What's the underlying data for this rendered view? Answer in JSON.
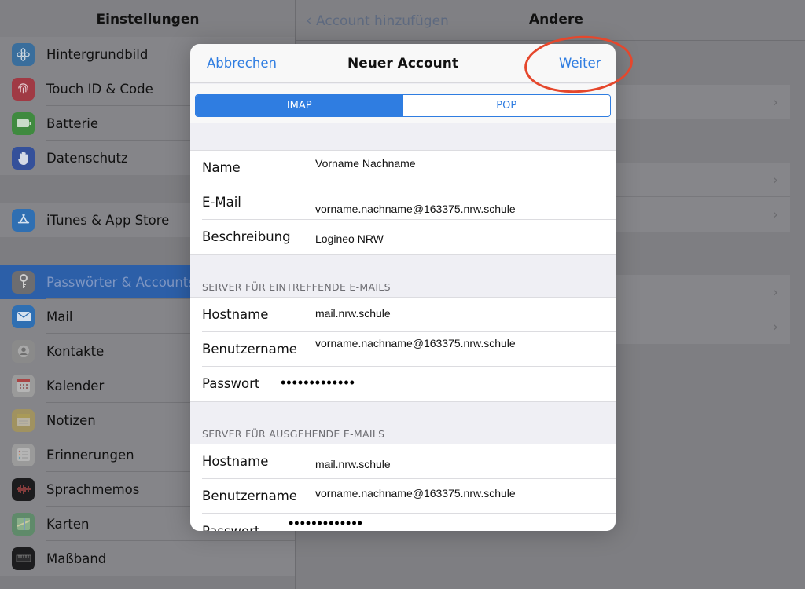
{
  "sidebar": {
    "title": "Einstellungen",
    "groups": [
      {
        "items": [
          {
            "label": "Hintergrundbild",
            "icon": "wallpaper-icon",
            "color": "#3a6e9c"
          },
          {
            "label": "Touch ID & Code",
            "icon": "fingerprint-icon",
            "color": "#a03a44"
          },
          {
            "label": "Batterie",
            "icon": "battery-icon",
            "color": "#3f8a3f"
          },
          {
            "label": "Datenschutz",
            "icon": "hand-icon",
            "color": "#34509a"
          }
        ]
      },
      {
        "items": [
          {
            "label": "iTunes & App Store",
            "icon": "app-store-icon",
            "color": "#2f6fb2"
          }
        ]
      },
      {
        "items": [
          {
            "label": "Passwörter & Accounts",
            "icon": "key-icon",
            "color": "#6d6d70",
            "selected": true
          },
          {
            "label": "Mail",
            "icon": "mail-icon",
            "color": "#2f6fb2"
          },
          {
            "label": "Kontakte",
            "icon": "contacts-icon",
            "color": "#8a8a8a"
          },
          {
            "label": "Kalender",
            "icon": "calendar-icon",
            "color": "#9a9a9a"
          },
          {
            "label": "Notizen",
            "icon": "notes-icon",
            "color": "#a09260"
          },
          {
            "label": "Erinnerungen",
            "icon": "reminders-icon",
            "color": "#9a9a9a"
          },
          {
            "label": "Sprachmemos",
            "icon": "voice-memo-icon",
            "color": "#1c1c1e"
          },
          {
            "label": "Karten",
            "icon": "maps-icon",
            "color": "#5f8a6a"
          },
          {
            "label": "Maßband",
            "icon": "measure-icon",
            "color": "#1c1c1e"
          }
        ]
      }
    ]
  },
  "detail": {
    "back_label": "Account hinzufügen",
    "title": "Andere"
  },
  "modal": {
    "cancel_label": "Abbrechen",
    "title": "Neuer Account",
    "next_label": "Weiter",
    "segments": [
      "IMAP",
      "POP"
    ],
    "selected_segment": "IMAP",
    "account": {
      "name_label": "Name",
      "name_value": "Vorname Nachname",
      "email_label": "E-Mail",
      "email_value": "vorname.nachname@163375.nrw.schule",
      "description_label": "Beschreibung",
      "description_value": "Logineo NRW"
    },
    "incoming": {
      "header": "SERVER FÜR EINTREFFENDE E-MAILS",
      "host_label": "Hostname",
      "host_value": "mail.nrw.schule",
      "user_label": "Benutzername",
      "user_value": "vorname.nachname@163375.nrw.schule",
      "password_label": "Passwort",
      "password_value": "•••••••••••••"
    },
    "outgoing": {
      "header": "SERVER FÜR AUSGEHENDE E-MAILS",
      "host_label": "Hostname",
      "host_value": "mail.nrw.schule",
      "user_label": "Benutzername",
      "user_value": "vorname.nachname@163375.nrw.schule",
      "password_label": "Passwort",
      "password_value": "•••••••••••••"
    }
  },
  "colors": {
    "accent": "#2f7de1",
    "highlight": "#e5472c"
  }
}
